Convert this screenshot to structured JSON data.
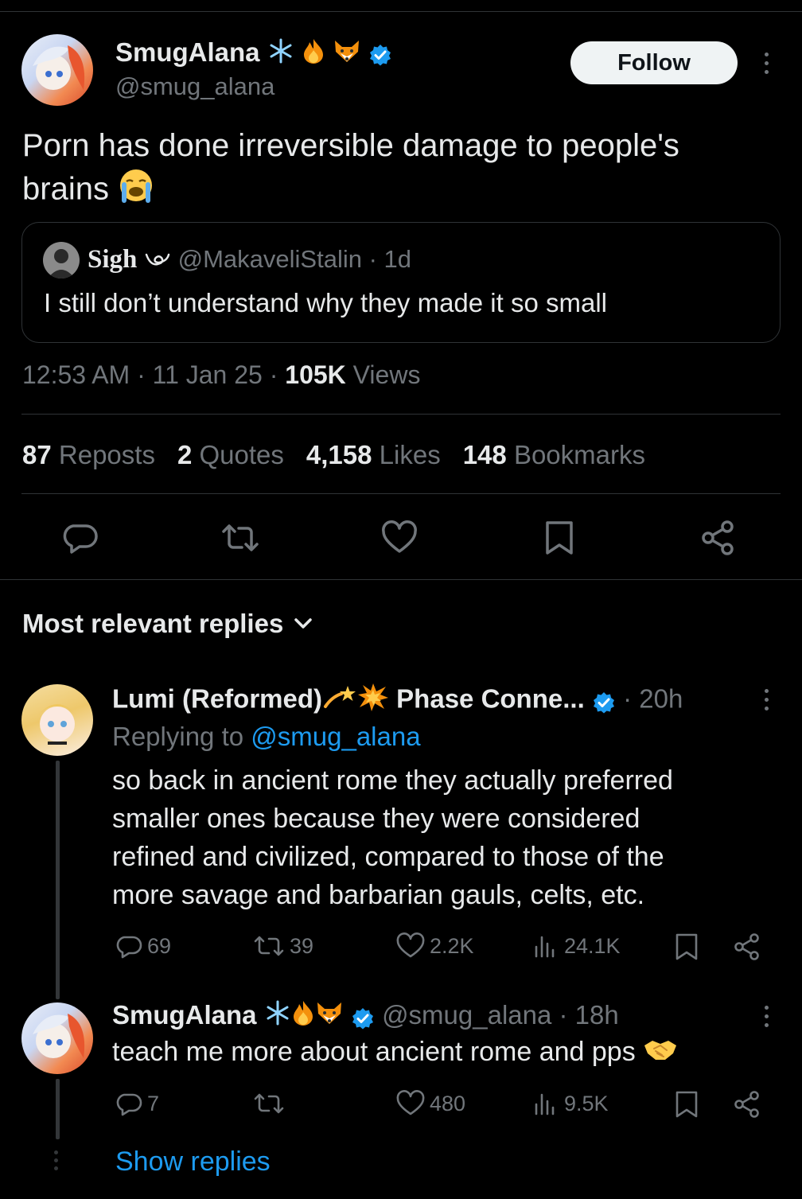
{
  "colors": {
    "background": "#000000",
    "text": "#e7e9ea",
    "muted": "#71767b",
    "link": "#1d9bf0",
    "border": "#2f3336",
    "verified": "#1d9bf0"
  },
  "post": {
    "author_name": "SmugAlana",
    "author_emojis": [
      "snowflake-emoji",
      "fire-emoji",
      "fox-emoji"
    ],
    "author_handle": "@smug_alana",
    "follow_label": "Follow",
    "text_line1": "Porn has done irreversible damage to people's",
    "text_line2": "brains",
    "text_emoji": "loudly-crying-face-emoji",
    "quote": {
      "name": "Sigh",
      "handle_time": "@MakaveliStalin · 1d",
      "text": "I still don’t understand why they made it so small"
    },
    "time": "12:53 AM · 11 Jan 25 · ",
    "views_count": "105K",
    "views_label": " Views",
    "stats": [
      {
        "count": "87",
        "label": "Reposts"
      },
      {
        "count": "2",
        "label": "Quotes"
      },
      {
        "count": "4,158",
        "label": "Likes"
      },
      {
        "count": "148",
        "label": "Bookmarks"
      }
    ],
    "actions": [
      "reply-icon",
      "repost-icon",
      "like-icon",
      "bookmark-icon",
      "share-icon"
    ]
  },
  "replies_header": "Most relevant replies",
  "replies": [
    {
      "name": "Lumi (Reformed)",
      "name_suffix": "Phase Conne...",
      "time": "· 20h",
      "replying_prefix": "Replying to ",
      "replying_handle": "@smug_alana",
      "lines": [
        "so back in ancient rome they actually preferred",
        "smaller ones because they were considered",
        "refined and civilized, compared to those of the",
        "more savage and barbarian gauls, celts, etc."
      ],
      "reply_count": "69",
      "repost_count": "39",
      "like_count": "2.2K",
      "view_count": "24.1K"
    },
    {
      "name": "SmugAlana",
      "handle_time": "@smug_alana · 18h",
      "text": "teach me more about ancient rome and pps",
      "reply_count": "7",
      "repost_count": "",
      "like_count": "480",
      "view_count": "9.5K"
    }
  ],
  "show_replies": "Show replies"
}
